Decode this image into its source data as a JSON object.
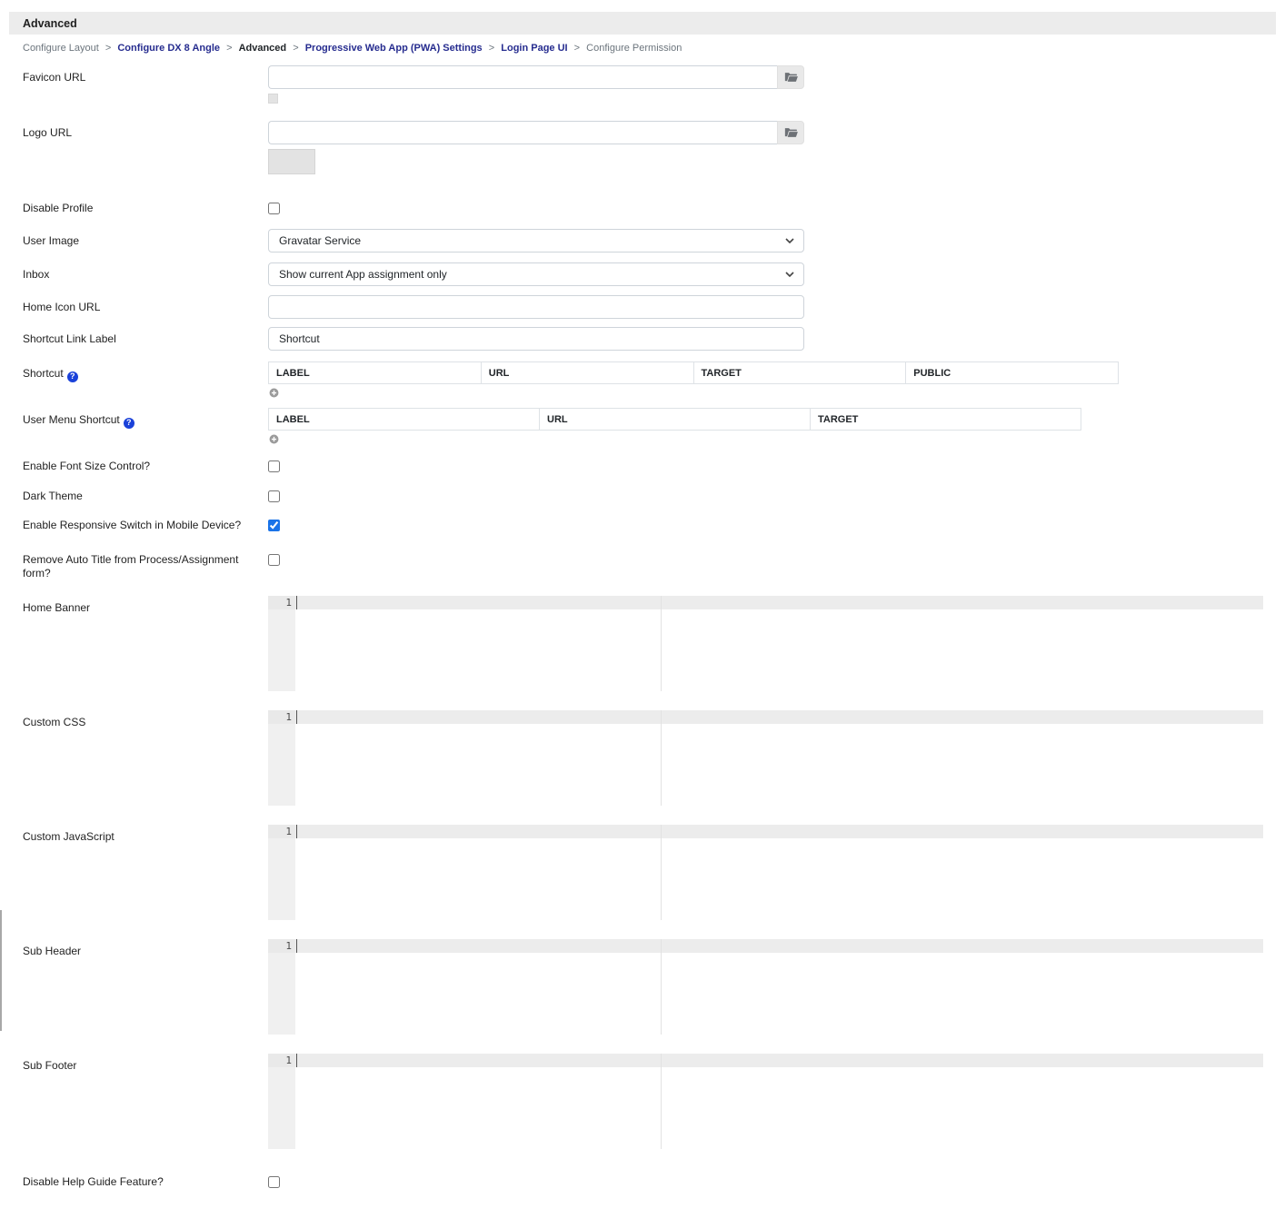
{
  "page": {
    "title": "Advanced"
  },
  "breadcrumb": {
    "separator": ">",
    "items": [
      {
        "label": "Configure Layout"
      },
      {
        "label": "Configure DX 8 Angle"
      },
      {
        "label": "Advanced"
      },
      {
        "label": "Progressive Web App (PWA) Settings"
      },
      {
        "label": "Login Page UI"
      },
      {
        "label": "Configure Permission"
      }
    ]
  },
  "colors": {
    "checkbox_accent": "#1a73e8",
    "breadcrumb_link": "#262c8f",
    "help_icon_blue": "#1a41d9",
    "header_bar_bg": "#ececec",
    "editor_gutter_bg": "#f0f0f0"
  },
  "fields": {
    "favicon_url": {
      "label": "Favicon URL",
      "value": ""
    },
    "logo_url": {
      "label": "Logo URL",
      "value": ""
    },
    "disable_profile": {
      "label": "Disable Profile",
      "checked": false
    },
    "user_image": {
      "label": "User Image",
      "value": "Gravatar Service"
    },
    "inbox": {
      "label": "Inbox",
      "value": "Show current App assignment only"
    },
    "home_icon_url": {
      "label": "Home Icon URL",
      "value": ""
    },
    "shortcut_link_label": {
      "label": "Shortcut Link Label",
      "value": "Shortcut"
    },
    "shortcut": {
      "label": "Shortcut",
      "columns": [
        "LABEL",
        "URL",
        "TARGET",
        "PUBLIC"
      ]
    },
    "user_menu_shortcut": {
      "label": "User Menu Shortcut",
      "columns": [
        "LABEL",
        "URL",
        "TARGET"
      ]
    },
    "enable_font_size_control": {
      "label": "Enable Font Size Control?",
      "checked": false
    },
    "dark_theme": {
      "label": "Dark Theme",
      "checked": false
    },
    "enable_responsive_switch": {
      "label": "Enable Responsive Switch in Mobile Device?",
      "checked": true
    },
    "remove_auto_title": {
      "label": "Remove Auto Title from Process/Assignment form?",
      "checked": false
    },
    "home_banner": {
      "label": "Home Banner",
      "line_number": "1",
      "value": ""
    },
    "custom_css": {
      "label": "Custom CSS",
      "line_number": "1",
      "value": ""
    },
    "custom_javascript": {
      "label": "Custom JavaScript",
      "line_number": "1",
      "value": ""
    },
    "sub_header": {
      "label": "Sub Header",
      "line_number": "1",
      "value": ""
    },
    "sub_footer": {
      "label": "Sub Footer",
      "line_number": "1",
      "value": ""
    },
    "disable_help_guide": {
      "label": "Disable Help Guide Feature?",
      "checked": false
    }
  }
}
